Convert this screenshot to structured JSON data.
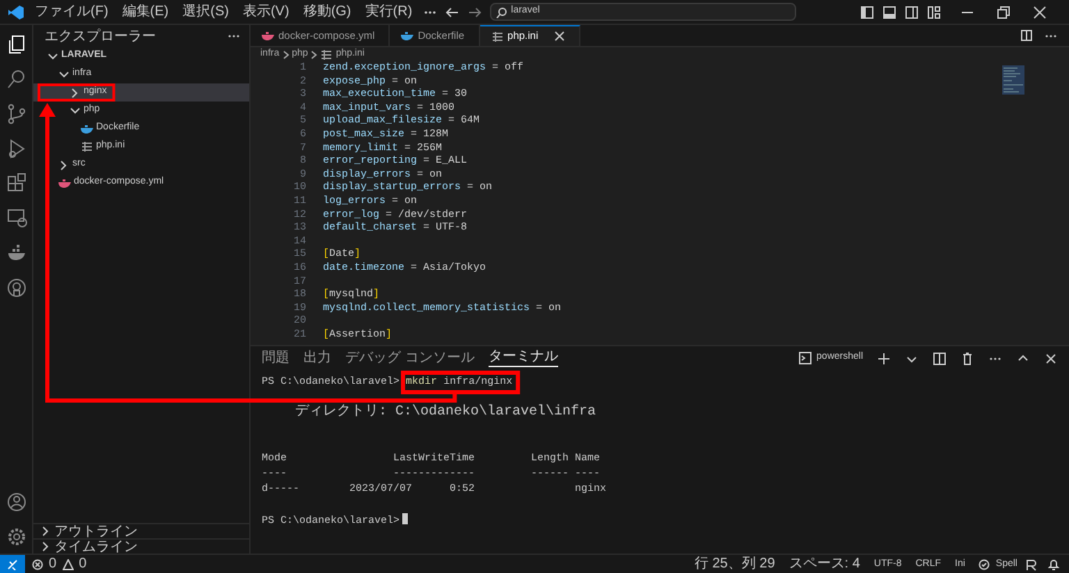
{
  "menu": [
    "ファイル(F)",
    "編集(E)",
    "選択(S)",
    "表示(V)",
    "移動(G)",
    "実行(R)"
  ],
  "search": {
    "value": "laravel"
  },
  "activity_bar": [
    {
      "kind": "files",
      "selected": true
    },
    {
      "kind": "search",
      "selected": false
    },
    {
      "kind": "scm",
      "selected": false
    },
    {
      "kind": "run",
      "selected": false
    },
    {
      "kind": "extensions",
      "selected": false
    },
    {
      "kind": "remote",
      "selected": false
    },
    {
      "kind": "docker",
      "selected": false
    },
    {
      "kind": "github",
      "selected": false
    }
  ],
  "explorer": {
    "title": "エクスプローラー",
    "tree": [
      {
        "label": "LARAVEL",
        "kind": "root",
        "expanded": true,
        "selected": false,
        "children": [
          {
            "label": "infra",
            "kind": "folder",
            "expanded": true,
            "selected": false,
            "children": [
              {
                "label": "nginx",
                "kind": "folder",
                "expanded": false,
                "selected": true
              },
              {
                "label": "php",
                "kind": "folder",
                "expanded": true,
                "selected": false,
                "children": [
                  {
                    "label": "Dockerfile",
                    "kind": "docker",
                    "selected": false
                  },
                  {
                    "label": "php.ini",
                    "kind": "ini",
                    "selected": false
                  }
                ]
              }
            ]
          },
          {
            "label": "src",
            "kind": "folder",
            "expanded": false,
            "selected": false
          },
          {
            "label": "docker-compose.yml",
            "kind": "compose",
            "selected": false
          }
        ]
      }
    ],
    "sections": [
      "アウトライン",
      "タイムライン"
    ]
  },
  "tabs": [
    {
      "label": "docker-compose.yml",
      "kind": "compose",
      "selected": false
    },
    {
      "label": "Dockerfile",
      "kind": "docker",
      "selected": false
    },
    {
      "label": "php.ini",
      "kind": "ini",
      "selected": true
    }
  ],
  "breadcrumb": [
    "infra",
    "php",
    "php.ini"
  ],
  "code": [
    {
      "number": "1",
      "kind": "setting",
      "key": "zend.exception_ignore_args",
      "operator": "=",
      "value": "off"
    },
    {
      "number": "2",
      "kind": "setting",
      "key": "expose_php",
      "operator": "=",
      "value": "on"
    },
    {
      "number": "3",
      "kind": "setting",
      "key": "max_execution_time",
      "operator": "=",
      "value": "30"
    },
    {
      "number": "4",
      "kind": "setting",
      "key": "max_input_vars",
      "operator": "=",
      "value": "1000"
    },
    {
      "number": "5",
      "kind": "setting",
      "key": "upload_max_filesize",
      "operator": "=",
      "value": "64M"
    },
    {
      "number": "6",
      "kind": "setting",
      "key": "post_max_size",
      "operator": "=",
      "value": "128M"
    },
    {
      "number": "7",
      "kind": "setting",
      "key": "memory_limit",
      "operator": "=",
      "value": "256M"
    },
    {
      "number": "8",
      "kind": "setting",
      "key": "error_reporting",
      "operator": "=",
      "value": "E_ALL"
    },
    {
      "number": "9",
      "kind": "setting",
      "key": "display_errors",
      "operator": "=",
      "value": "on"
    },
    {
      "number": "10",
      "kind": "setting",
      "key": "display_startup_errors",
      "operator": "=",
      "value": "on"
    },
    {
      "number": "11",
      "kind": "setting",
      "key": "log_errors",
      "operator": "=",
      "value": "on"
    },
    {
      "number": "12",
      "kind": "setting",
      "key": "error_log",
      "operator": "=",
      "value": "/dev/stderr"
    },
    {
      "number": "13",
      "kind": "setting",
      "key": "default_charset",
      "operator": "=",
      "value": "UTF-8"
    },
    {
      "number": "14",
      "kind": "blank"
    },
    {
      "number": "15",
      "kind": "section",
      "open": "[",
      "name": "Date",
      "close": "]"
    },
    {
      "number": "16",
      "kind": "setting",
      "key": "date.timezone",
      "operator": "=",
      "value": "Asia/Tokyo"
    },
    {
      "number": "17",
      "kind": "blank"
    },
    {
      "number": "18",
      "kind": "section",
      "open": "[",
      "name": "mysqlnd",
      "close": "]"
    },
    {
      "number": "19",
      "kind": "setting",
      "key": "mysqlnd.collect_memory_statistics",
      "operator": "=",
      "value": "on"
    },
    {
      "number": "20",
      "kind": "blank"
    },
    {
      "number": "21",
      "kind": "section",
      "open": "[",
      "name": "Assertion",
      "close": "]"
    }
  ],
  "panel": {
    "tabs": [
      {
        "label": "問題",
        "selected": false
      },
      {
        "label": "出力",
        "selected": false
      },
      {
        "label": "デバッグ コンソール",
        "selected": false
      },
      {
        "label": "ターミナル",
        "selected": true
      }
    ],
    "shell": "powershell",
    "terminal": [
      {
        "kind": "prompt",
        "prompt": "PS C:\\odaneko\\laravel>",
        "command": "mkdir",
        "args": "infra/nginx",
        "cursor": false
      },
      {
        "kind": "blank"
      },
      {
        "kind": "jp",
        "text": "    ディレクトリ: C:\\odaneko\\laravel\\infra"
      },
      {
        "kind": "blank"
      },
      {
        "kind": "blank"
      },
      {
        "kind": "text",
        "text": "Mode                 LastWriteTime         Length Name"
      },
      {
        "kind": "text",
        "text": "----                 -------------         ------ ----"
      },
      {
        "kind": "text",
        "text": "d-----        2023/07/07      0:52                nginx"
      },
      {
        "kind": "blank"
      },
      {
        "kind": "prompt",
        "prompt": "PS C:\\odaneko\\laravel>",
        "cursor": true
      }
    ]
  },
  "status_bar": {
    "errors": "0",
    "warnings": "0",
    "items": [
      "行 25、列 29",
      "スペース: 4",
      "UTF-8",
      "CRLF",
      "Ini"
    ],
    "spell": "Spell"
  }
}
